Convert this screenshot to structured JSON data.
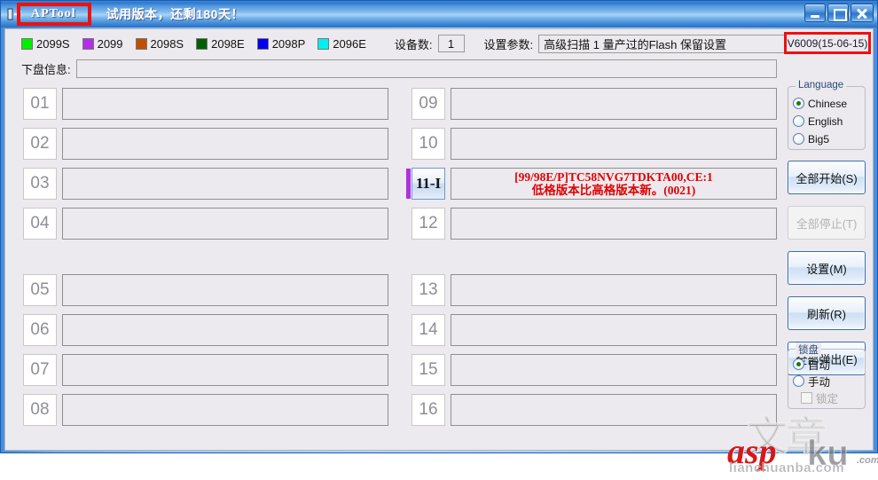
{
  "window": {
    "title": "APTool",
    "trial_notice": "试用版本，还剩180天！",
    "icon": "usb-device-icon",
    "buttons": {
      "minimize": "minimize-icon",
      "maximize": "maximize-icon",
      "close": "close-icon"
    }
  },
  "toolbar": {
    "legend": [
      {
        "label": "2099S",
        "color": "#00f000"
      },
      {
        "label": "2099",
        "color": "#b030e8"
      },
      {
        "label": "2098S",
        "color": "#c05000"
      },
      {
        "label": "2098E",
        "color": "#006000"
      },
      {
        "label": "2098P",
        "color": "#0000f0"
      },
      {
        "label": "2096E",
        "color": "#00f0f0"
      }
    ],
    "device_count_label": "设备数:",
    "device_count_value": "1",
    "param_label": "设置参数:",
    "param_value": "高级扫描 1 量产过的Flash 保留设置",
    "version": "V6009(15-06-15)"
  },
  "info_row": {
    "label": "下盘信息:",
    "value": ""
  },
  "ports": {
    "left": [
      {
        "num": "01",
        "message": [],
        "active": false,
        "accent": ""
      },
      {
        "num": "02",
        "message": [],
        "active": false,
        "accent": ""
      },
      {
        "num": "03",
        "message": [],
        "active": false,
        "accent": ""
      },
      {
        "num": "04",
        "message": [],
        "active": false,
        "accent": ""
      },
      {
        "num": "05",
        "message": [],
        "active": false,
        "accent": ""
      },
      {
        "num": "06",
        "message": [],
        "active": false,
        "accent": ""
      },
      {
        "num": "07",
        "message": [],
        "active": false,
        "accent": ""
      },
      {
        "num": "08",
        "message": [],
        "active": false,
        "accent": ""
      }
    ],
    "right": [
      {
        "num": "09",
        "message": [],
        "active": false,
        "accent": ""
      },
      {
        "num": "10",
        "message": [],
        "active": false,
        "accent": ""
      },
      {
        "num": "11-I",
        "message": [
          "[99/98E/P]TC58NVG7TDKTA00,CE:1",
          "低格版本比高格版本新。(0021)"
        ],
        "active": true,
        "accent": "#b030e0"
      },
      {
        "num": "12",
        "message": [],
        "active": false,
        "accent": ""
      },
      {
        "num": "13",
        "message": [],
        "active": false,
        "accent": ""
      },
      {
        "num": "14",
        "message": [],
        "active": false,
        "accent": ""
      },
      {
        "num": "15",
        "message": [],
        "active": false,
        "accent": ""
      },
      {
        "num": "16",
        "message": [],
        "active": false,
        "accent": ""
      }
    ]
  },
  "side_panel": {
    "language_group": {
      "title": "Language",
      "options": [
        {
          "label": "Chinese",
          "checked": true
        },
        {
          "label": "English",
          "checked": false
        },
        {
          "label": "Big5",
          "checked": false
        }
      ]
    },
    "buttons": [
      {
        "label": "全部开始(S)",
        "enabled": true
      },
      {
        "label": "全部停止(T)",
        "enabled": false
      },
      {
        "label": "设置(M)",
        "enabled": true
      },
      {
        "label": "刷新(R)",
        "enabled": true
      },
      {
        "label": "全部弹出(E)",
        "enabled": true
      }
    ],
    "lock_group": {
      "title": "锁盘",
      "options": [
        {
          "label": "自动",
          "checked": true
        },
        {
          "label": "手动",
          "checked": false
        }
      ],
      "checkbox": {
        "label": "锁定",
        "checked": false,
        "enabled": false
      }
    }
  },
  "watermark": {
    "gray_top": "文章",
    "red": "asp",
    "ku": "ku",
    "soft": ".com",
    "sub": "lianchuanba.com"
  }
}
